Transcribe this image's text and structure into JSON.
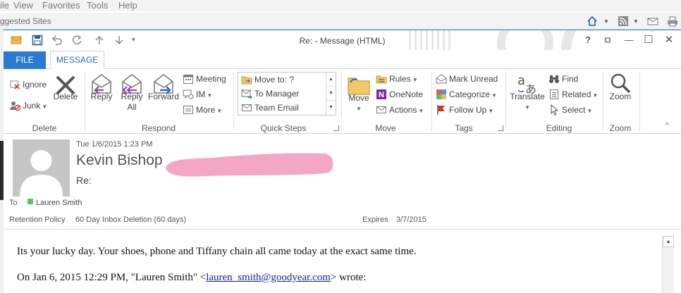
{
  "ie": {
    "menu": [
      "ile",
      "View",
      "Favorites",
      "Tools",
      "Help"
    ],
    "favorites_bar": "ggested Sites"
  },
  "window": {
    "title": "Re: - Message (HTML)",
    "help": "?",
    "restore_ribbon": "⧉",
    "minimize": "—",
    "maximize": "☐",
    "close": "✕"
  },
  "tabs": {
    "file": "FILE",
    "message": "MESSAGE"
  },
  "ribbon": {
    "delete_group": {
      "label": "Delete",
      "ignore": "Ignore",
      "junk": "Junk",
      "delete": "Delete"
    },
    "respond_group": {
      "label": "Respond",
      "reply": "Reply",
      "reply_all_1": "Reply",
      "reply_all_2": "All",
      "forward": "Forward",
      "meeting": "Meeting",
      "im": "IM",
      "more": "More"
    },
    "quick_steps": {
      "label": "Quick Steps",
      "items": [
        "Move to: ?",
        "To Manager",
        "Team Email"
      ]
    },
    "move_group": {
      "label": "Move",
      "move": "Move",
      "rules": "Rules",
      "onenote": "OneNote",
      "actions": "Actions"
    },
    "tags_group": {
      "label": "Tags",
      "mark_unread": "Mark Unread",
      "categorize": "Categorize",
      "follow_up": "Follow Up"
    },
    "editing_group": {
      "label": "Editing",
      "translate": "Translate",
      "find": "Find",
      "related": "Related",
      "select": "Select"
    },
    "zoom_group": {
      "label": "Zoom",
      "zoom": "Zoom"
    }
  },
  "header": {
    "date": "Tue 1/6/2015 1:23 PM",
    "sender": "Kevin Bishop",
    "subject": "Re:",
    "to_label": "To",
    "to_name": "Lauren Smith",
    "retention_label": "Retention Policy",
    "retention_value": "60 Day Inbox Deletion (60 days)",
    "expires_label": "Expires",
    "expires_value": "3/7/2015"
  },
  "body": {
    "line1": "Its your lucky day. Your shoes, phone and Tiffany chain all came today at the exact same time.",
    "line2_prefix": "On Jan 6, 2015 12:29 PM, \"Lauren Smith\" <",
    "line2_link": "lauren_smith@goodyear.com",
    "line2_suffix": "> wrote:"
  },
  "colors": {
    "accent": "#2b7bd0",
    "redaction": "#f4a7c4",
    "presence": "#5cc65c",
    "link": "#1a1aa6"
  }
}
